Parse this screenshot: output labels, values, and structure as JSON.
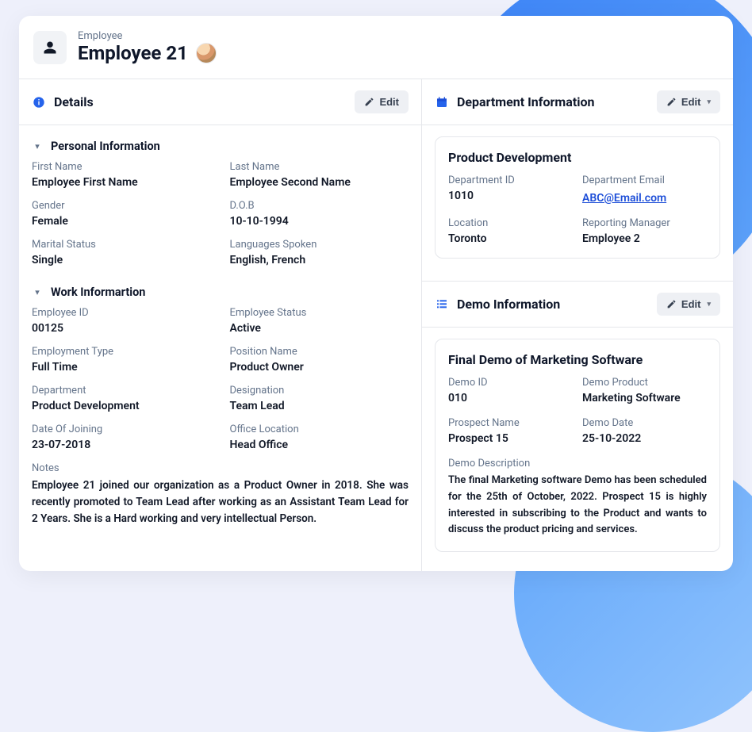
{
  "header": {
    "supertitle": "Employee",
    "title": "Employee 21"
  },
  "details": {
    "section_title": "Details",
    "edit_label": "Edit",
    "personal": {
      "title": "Personal Information",
      "first_name_label": "First Name",
      "first_name": "Employee First Name",
      "last_name_label": "Last Name",
      "last_name": "Employee Second Name",
      "gender_label": "Gender",
      "gender": "Female",
      "dob_label": "D.O.B",
      "dob": "10-10-1994",
      "marital_status_label": "Marital Status",
      "marital_status": "Single",
      "languages_label": "Languages Spoken",
      "languages": "English, French"
    },
    "work": {
      "title": "Work Informartion",
      "employee_id_label": "Employee ID",
      "employee_id": "00125",
      "employee_status_label": "Employee Status",
      "employee_status": "Active",
      "employment_type_label": "Employment Type",
      "employment_type": "Full Time",
      "position_name_label": "Position Name",
      "position_name": "Product Owner",
      "department_label": "Department",
      "department": "Product Development",
      "designation_label": "Designation",
      "designation": "Team Lead",
      "doj_label": "Date Of Joining",
      "doj": "23-07-2018",
      "office_location_label": "Office Location",
      "office_location": "Head Office",
      "notes_label": "Notes",
      "notes": "Employee 21 joined our organization as a Product Owner in 2018. She was recently promoted to Team Lead after working as an Assistant Team Lead for 2 Years. She is a Hard working and very intellectual Person."
    }
  },
  "department_info": {
    "section_title": "Department Information",
    "edit_label": "Edit",
    "department_name": "Product Development",
    "id_label": "Department ID",
    "id": "1010",
    "email_label": "Department Email",
    "email": "ABC@Email.com",
    "location_label": "Location",
    "location": "Toronto",
    "reporting_manager_label": "Reporting Manager",
    "reporting_manager": "Employee 2"
  },
  "demo_info": {
    "section_title": "Demo Information",
    "edit_label": "Edit",
    "demo_title": "Final Demo of Marketing Software",
    "demo_id_label": "Demo ID",
    "demo_id": "010",
    "demo_product_label": "Demo Product",
    "demo_product": "Marketing Software",
    "prospect_name_label": "Prospect Name",
    "prospect_name": "Prospect 15",
    "demo_date_label": "Demo Date",
    "demo_date": "25-10-2022",
    "demo_description_label": "Demo Description",
    "demo_description": "The final Marketing software Demo has been scheduled for the 25th of October, 2022. Prospect 15 is highly interested in subscribing to the Product and wants to discuss the product pricing and services."
  }
}
